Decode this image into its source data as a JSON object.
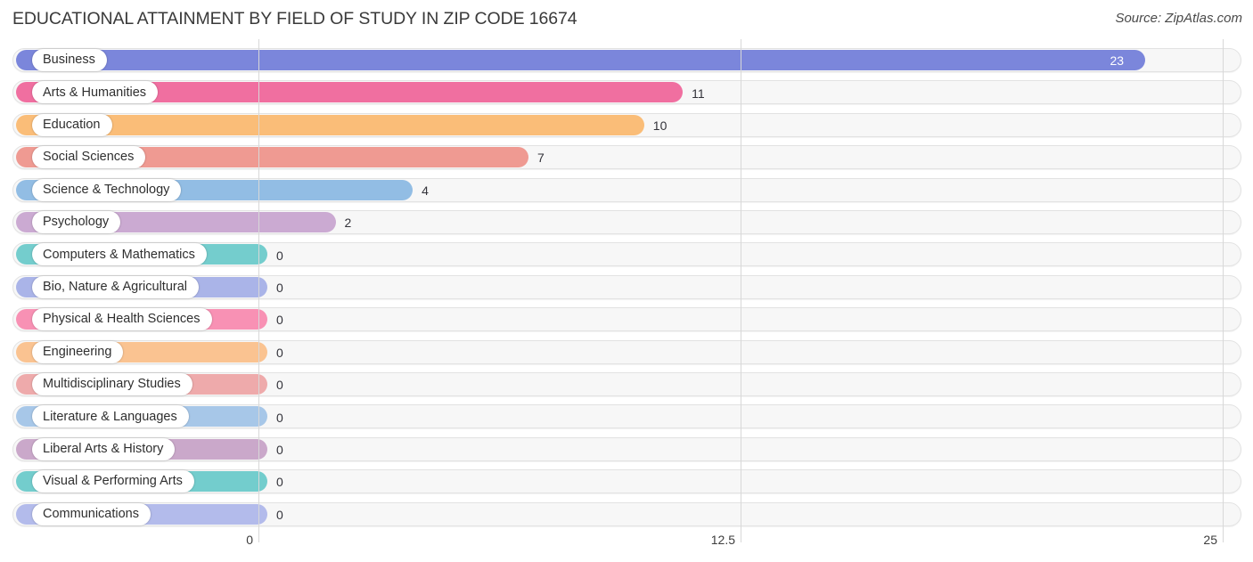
{
  "header": {
    "title": "EDUCATIONAL ATTAINMENT BY FIELD OF STUDY IN ZIP CODE 16674",
    "source": "Source: ZipAtlas.com"
  },
  "chart_data": {
    "type": "bar",
    "orientation": "horizontal",
    "title": "EDUCATIONAL ATTAINMENT BY FIELD OF STUDY IN ZIP CODE 16674",
    "xlabel": "",
    "ylabel": "",
    "xlim": [
      0,
      25
    ],
    "xticks": [
      "0",
      "12.5",
      "25"
    ],
    "xtick_values": [
      0,
      12.5,
      25
    ],
    "grid": true,
    "legend": false,
    "categories": [
      "Business",
      "Arts & Humanities",
      "Education",
      "Social Sciences",
      "Science & Technology",
      "Psychology",
      "Computers & Mathematics",
      "Bio, Nature & Agricultural",
      "Physical & Health Sciences",
      "Engineering",
      "Multidisciplinary Studies",
      "Literature & Languages",
      "Liberal Arts & History",
      "Visual & Performing Arts",
      "Communications"
    ],
    "values": [
      23,
      11,
      10,
      7,
      4,
      2,
      0,
      0,
      0,
      0,
      0,
      0,
      0,
      0,
      0
    ],
    "value_labels": [
      "23",
      "11",
      "10",
      "7",
      "4",
      "2",
      "0",
      "0",
      "0",
      "0",
      "0",
      "0",
      "0",
      "0",
      "0"
    ],
    "bar_colors": [
      "#7b86db",
      "#f06fa0",
      "#fabd78",
      "#ef9a92",
      "#92bde4",
      "#cbaad2",
      "#74cdcd",
      "#aab4e8",
      "#f891b4",
      "#fac391",
      "#eeaaab",
      "#a7c7e8",
      "#caa8ca",
      "#73cdcd",
      "#b3bbeb"
    ]
  },
  "axis": {
    "ticks": [
      "0",
      "12.5",
      "25"
    ]
  }
}
